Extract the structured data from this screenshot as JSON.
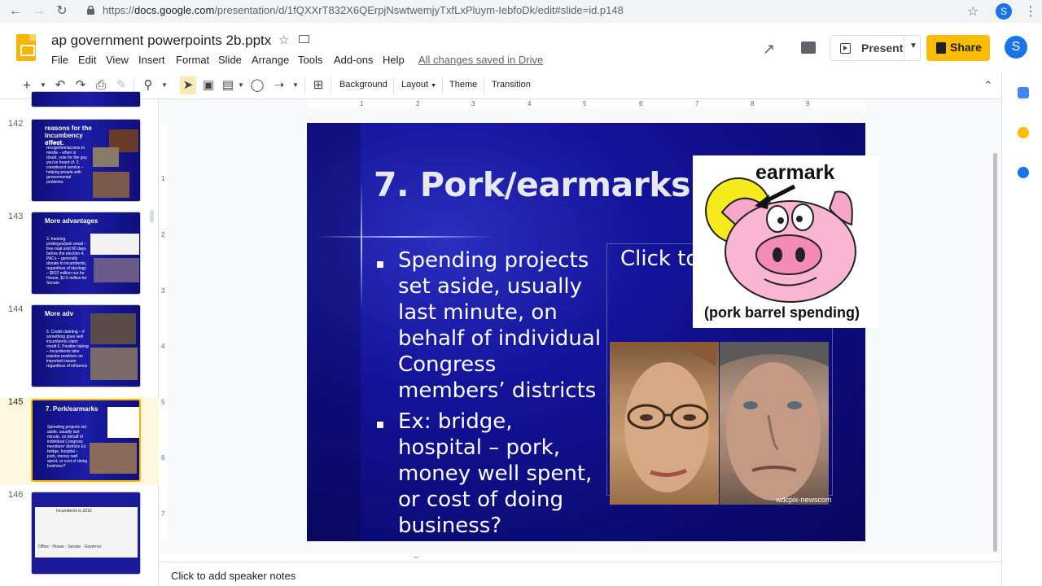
{
  "browser": {
    "url_prefix": "https://",
    "url_host": "docs.google.com",
    "url_path": "/presentation/d/1fQXXrT832X6QErpjNswtwemjyTxfLxPluym-IebfoDk/edit#slide=id.p148",
    "profile_initial": "S"
  },
  "doc": {
    "title": "ap government powerpoints 2b.pptx",
    "save_status": "All changes saved in Drive",
    "present_label": "Present",
    "share_label": "Share",
    "profile_initial": "S"
  },
  "menu": [
    "File",
    "Edit",
    "View",
    "Insert",
    "Format",
    "Slide",
    "Arrange",
    "Tools",
    "Add-ons",
    "Help"
  ],
  "toolbar": {
    "background_label": "Background",
    "layout_label": "Layout",
    "theme_label": "Theme",
    "transition_label": "Transition"
  },
  "ruler": {
    "h": [
      "1",
      "2",
      "3",
      "4",
      "5",
      "6",
      "7",
      "8",
      "9"
    ],
    "v": [
      "1",
      "2",
      "3",
      "4",
      "5",
      "6",
      "7"
    ]
  },
  "filmstrip": [
    {
      "num": "142",
      "title": "reasons for the incumbency effect.",
      "body": "1. name recognition/access to media – when in doubt, vote for the guy you've heard of.\n2. constituent service – helping people with governmental problems"
    },
    {
      "num": "143",
      "title": "More advantages",
      "body": "3. franking privileges/junk email – free mail until 90 days before the election\n4. PACs – generally donate to incumbents, regardless of ideology – $622 million run for House, $2.5 million for Senate"
    },
    {
      "num": "144",
      "title": "More adv",
      "body": "5. Credit claiming – if something goes well incumbents claim credit\n6. Position taking – incumbents take popular positions on important issues regardless of influence"
    },
    {
      "num": "145",
      "title": "7. Pork/earmarks",
      "body": "Spending projects set aside, usually last minute, on behalf of individual Congress members' districts\nEx: bridge, hospital – pork, money well spent, or cost of doing business?"
    },
    {
      "num": "146",
      "title": "Incumbents in 2016",
      "body": "Office · House · Senate · Governor"
    }
  ],
  "slide": {
    "title": "7. Pork/earmarks",
    "bullets": [
      "Spending projects set aside, usually last minute, on behalf of individual Congress members’ districts",
      "Ex:  bridge, hospital – pork, money well spent, or cost of doing business?"
    ],
    "placeholder": "Click to",
    "photo_credit": "wdcpix-newscom",
    "pig_label_top": "earmark",
    "pig_label_bottom": "(pork barrel spending)"
  },
  "notes": {
    "placeholder": "Click to add speaker notes"
  },
  "colors": {
    "accent_share": "#fbbc04",
    "profile_blue": "#1a73e8",
    "selected_thumb_bg": "#fef7e0"
  }
}
